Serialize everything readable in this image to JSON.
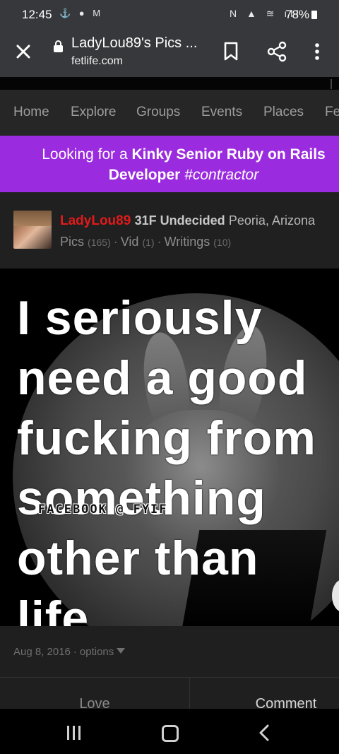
{
  "status_bar": {
    "time": "12:45",
    "left_icons": "⚓ ● M",
    "right_icons": "N ▲ ≋ ıll",
    "battery": "78%"
  },
  "browser": {
    "page_title": "LadyLou89's Pics ...",
    "domain": "fetlife.com"
  },
  "nav": {
    "items": [
      "Home",
      "Explore",
      "Groups",
      "Events",
      "Places",
      "Fe"
    ]
  },
  "banner": {
    "prefix": "Looking for a ",
    "bold1": "Kinky Senior Ruby on Rails",
    "bold2": "Developer",
    "tag": "#contractor"
  },
  "profile": {
    "name": "LadyLou89",
    "meta": "31F Undecided",
    "location": "Peoria, Arizona",
    "links": [
      {
        "label": "Pics",
        "count": "(165)"
      },
      {
        "label": "Vid",
        "count": "(1)"
      },
      {
        "label": "Writings",
        "count": "(10)"
      }
    ],
    "separator": "·"
  },
  "photo": {
    "lines": [
      "I seriously",
      "need a good",
      "fucking from",
      "something",
      "other than",
      "life."
    ],
    "watermark": "FACEBOOK @ FYIF"
  },
  "post": {
    "date": "Aug 8, 2016",
    "separator": "·",
    "options": "options"
  },
  "actions": {
    "love": "Love",
    "comment": "Comment"
  }
}
